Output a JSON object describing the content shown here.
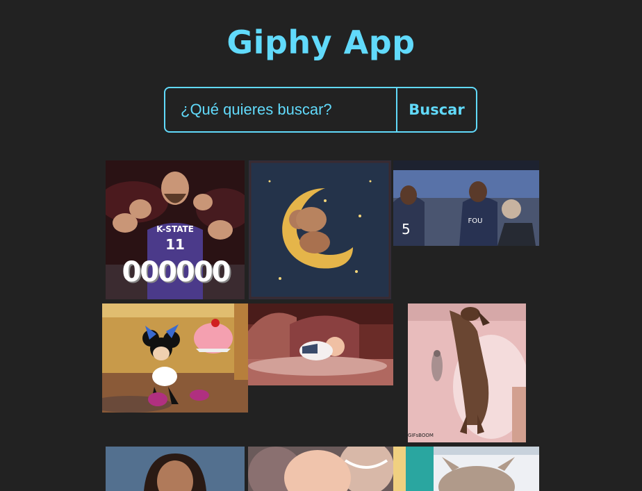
{
  "app": {
    "title": "Giphy App"
  },
  "search": {
    "placeholder": "¿Qué quieres buscar?",
    "value": "",
    "button_label": "Buscar"
  },
  "gifs": [
    {
      "name": "kstate-basketball-fan",
      "overlay_text": "000000"
    },
    {
      "name": "teddy-bear-moon"
    },
    {
      "name": "basketball-players-celebrating",
      "jersey_text": "FOU"
    },
    {
      "name": "minnie-mouse-cake"
    },
    {
      "name": "baby-on-couch"
    },
    {
      "name": "dog-in-bathtub",
      "watermark": "GIFsBOOM"
    },
    {
      "name": "man-portrait"
    },
    {
      "name": "laughing-baby"
    },
    {
      "name": "cartoon-owl"
    }
  ]
}
